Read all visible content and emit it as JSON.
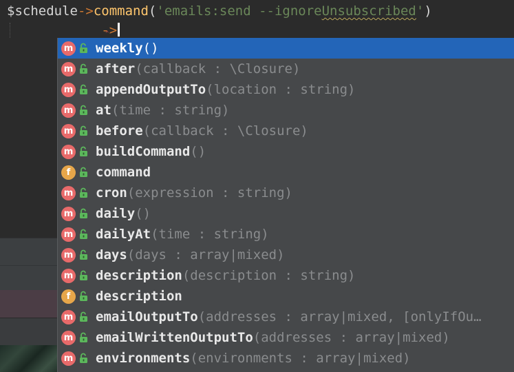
{
  "editor": {
    "line1": {
      "variable": "$schedule",
      "arrow": "->",
      "method": "command",
      "open_paren": "(",
      "string_prefix": "'emails:send --ignore",
      "string_squiggle": "Unsubscribed",
      "string_suffix": "'",
      "close_paren": ")"
    },
    "line2": {
      "indent": "            ",
      "arrow": "->"
    }
  },
  "completion": {
    "items": [
      {
        "kind": "m",
        "name": "weekly",
        "params": "()",
        "selected": true
      },
      {
        "kind": "m",
        "name": "after",
        "params": "(callback : \\Closure)"
      },
      {
        "kind": "m",
        "name": "appendOutputTo",
        "params": "(location : string)"
      },
      {
        "kind": "m",
        "name": "at",
        "params": "(time : string)"
      },
      {
        "kind": "m",
        "name": "before",
        "params": "(callback : \\Closure)"
      },
      {
        "kind": "m",
        "name": "buildCommand",
        "params": "()"
      },
      {
        "kind": "f",
        "name": "command",
        "params": ""
      },
      {
        "kind": "m",
        "name": "cron",
        "params": "(expression : string)"
      },
      {
        "kind": "m",
        "name": "daily",
        "params": "()"
      },
      {
        "kind": "m",
        "name": "dailyAt",
        "params": "(time : string)"
      },
      {
        "kind": "m",
        "name": "days",
        "params": "(days : array|mixed)"
      },
      {
        "kind": "m",
        "name": "description",
        "params": "(description : string)"
      },
      {
        "kind": "f",
        "name": "description",
        "params": ""
      },
      {
        "kind": "m",
        "name": "emailOutputTo",
        "params": "(addresses : array|mixed, [onlyIfOu…"
      },
      {
        "kind": "m",
        "name": "emailWrittenOutputTo",
        "params": "(addresses : array|mixed)"
      },
      {
        "kind": "m",
        "name": "environments",
        "params": "(environments : array|mixed)"
      },
      {
        "kind": "m",
        "name": "",
        "params": ""
      }
    ],
    "visibility_icon": "unlocked-padlock-icon",
    "colors": {
      "selected_bg": "#2365b8",
      "method_badge": "#e86a6a",
      "field_badge": "#e6a64a",
      "lock_green": "#5cb85c"
    }
  }
}
